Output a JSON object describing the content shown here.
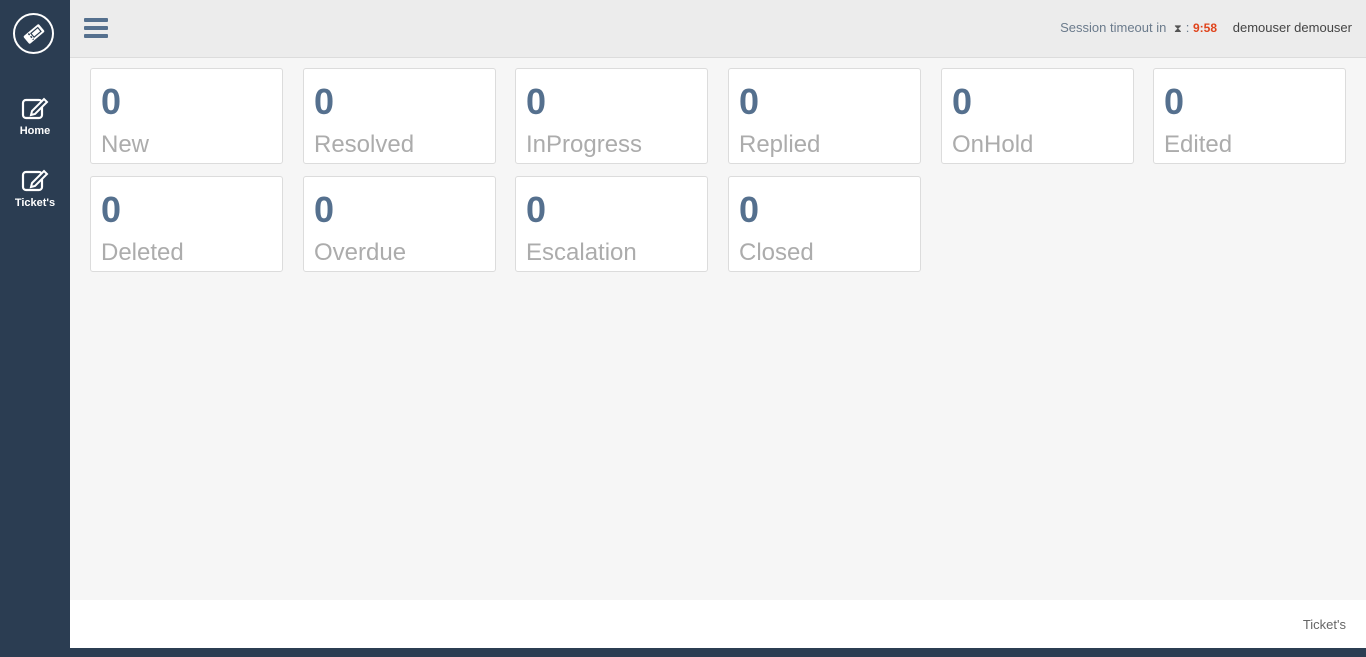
{
  "sidebar": {
    "logo_icon": "ticket-logo-icon",
    "items": [
      {
        "label": "Home",
        "icon": "edit-icon"
      },
      {
        "label": "Ticket's",
        "icon": "edit-icon"
      }
    ]
  },
  "header": {
    "menu_icon": "hamburger-menu-icon",
    "session_label": "Session timeout in",
    "session_separator": ":",
    "session_timer": "9:58",
    "user_name": "demouser demouser"
  },
  "cards": [
    {
      "count": "0",
      "label": "New"
    },
    {
      "count": "0",
      "label": "Resolved"
    },
    {
      "count": "0",
      "label": "InProgress"
    },
    {
      "count": "0",
      "label": "Replied"
    },
    {
      "count": "0",
      "label": "OnHold"
    },
    {
      "count": "0",
      "label": "Edited"
    },
    {
      "count": "0",
      "label": "Deleted"
    },
    {
      "count": "0",
      "label": "Overdue"
    },
    {
      "count": "0",
      "label": "Escalation"
    },
    {
      "count": "0",
      "label": "Closed"
    }
  ],
  "footer": {
    "text": "Ticket's"
  },
  "colors": {
    "sidebar": "#2b3d52",
    "count_text": "#55708e",
    "timer": "#e0441c",
    "label_text": "#acacac"
  }
}
